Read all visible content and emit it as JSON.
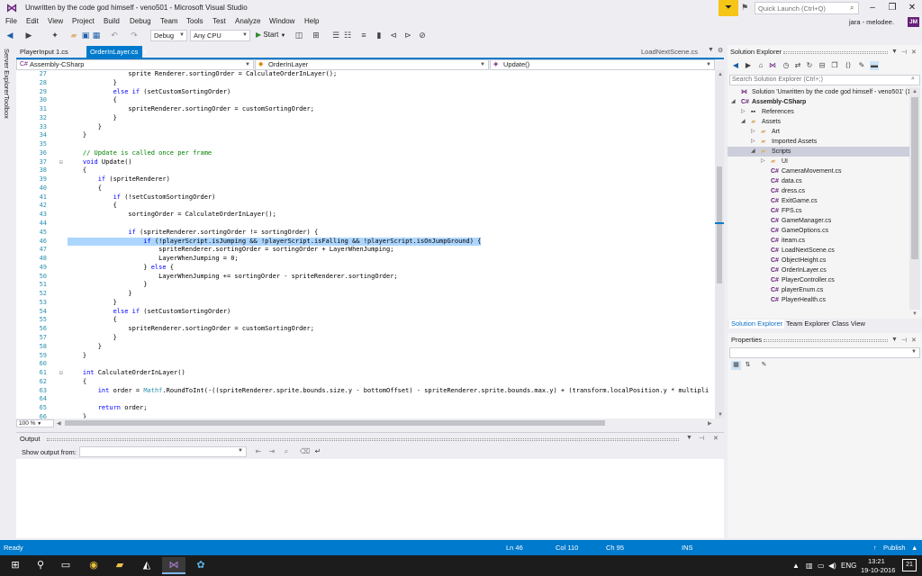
{
  "window": {
    "title": "Unwritten by the code god himself - veno501 - Microsoft Visual Studio",
    "quick_launch_placeholder": "Quick Launch (Ctrl+Q)",
    "user": "jara - melodee.",
    "avatar": "JM"
  },
  "menu": [
    "File",
    "Edit",
    "View",
    "Project",
    "Build",
    "Debug",
    "Team",
    "Tools",
    "Test",
    "Analyze",
    "Window",
    "Help"
  ],
  "toolbar": {
    "config": "Debug",
    "platform": "Any CPU",
    "start_label": "Start"
  },
  "left_strip": [
    "Server Explorer",
    "Toolbox"
  ],
  "tabs": {
    "inactive": "PlayerInput 1.cs",
    "active": "OrderInLayer.cs",
    "preview": "LoadNextScene.cs",
    "close": "×"
  },
  "nav": {
    "project": "Assembly-CSharp",
    "class": "OrderInLayer",
    "member": "Update()"
  },
  "code": [
    {
      "n": "27",
      "t": "                sprite Renderer.sortingOrder = CalculateOrderInLayer();"
    },
    {
      "n": "28",
      "t": "            }"
    },
    {
      "n": "29",
      "t": "            else if (setCustomSortingOrder)"
    },
    {
      "n": "30",
      "t": "            {"
    },
    {
      "n": "31",
      "t": "                spriteRenderer.sortingOrder = customSortingOrder;"
    },
    {
      "n": "32",
      "t": "            }"
    },
    {
      "n": "33",
      "t": "        }"
    },
    {
      "n": "34",
      "t": "    }"
    },
    {
      "n": "35",
      "t": ""
    },
    {
      "n": "36",
      "t": "    // Update is called once per frame"
    },
    {
      "n": "37",
      "t": "    void Update()"
    },
    {
      "n": "38",
      "t": "    {"
    },
    {
      "n": "39",
      "t": "        if (spriteRenderer)"
    },
    {
      "n": "40",
      "t": "        {"
    },
    {
      "n": "41",
      "t": "            if (!setCustomSortingOrder)"
    },
    {
      "n": "42",
      "t": "            {"
    },
    {
      "n": "43",
      "t": "                sortingOrder = CalculateOrderInLayer();"
    },
    {
      "n": "44",
      "t": ""
    },
    {
      "n": "45",
      "t": "                if (spriteRenderer.sortingOrder != sortingOrder) {"
    },
    {
      "n": "46",
      "t": "                    if (!playerScript.isJumping && !playerScript.isFalling && !playerScript.isOnJumpGround) {"
    },
    {
      "n": "47",
      "t": "                        spriteRenderer.sortingOrder = sortingOrder + LayerWhenJumping;"
    },
    {
      "n": "48",
      "t": "                        LayerWhenJumping = 0;"
    },
    {
      "n": "49",
      "t": "                    } else {"
    },
    {
      "n": "50",
      "t": "                        LayerWhenJumping += sortingOrder - spriteRenderer.sortingOrder;"
    },
    {
      "n": "51",
      "t": "                    }"
    },
    {
      "n": "52",
      "t": "                }"
    },
    {
      "n": "53",
      "t": "            }"
    },
    {
      "n": "54",
      "t": "            else if (setCustomSortingOrder)"
    },
    {
      "n": "55",
      "t": "            {"
    },
    {
      "n": "56",
      "t": "                spriteRenderer.sortingOrder = customSortingOrder;"
    },
    {
      "n": "57",
      "t": "            }"
    },
    {
      "n": "58",
      "t": "        }"
    },
    {
      "n": "59",
      "t": "    }"
    },
    {
      "n": "60",
      "t": ""
    },
    {
      "n": "61",
      "t": "    int CalculateOrderInLayer()"
    },
    {
      "n": "62",
      "t": "    {"
    },
    {
      "n": "63",
      "t": "        int order = Mathf.RoundToInt(-((spriteRenderer.sprite.bounds.size.y - bottomOffset) - spriteRenderer.sprite.bounds.max.y) + (transform.localPosition.y * multipli"
    },
    {
      "n": "64",
      "t": ""
    },
    {
      "n": "65",
      "t": "        return order;"
    },
    {
      "n": "66",
      "t": "    }"
    }
  ],
  "highlight_line": "46",
  "editor_zoom": "100 %",
  "output": {
    "title": "Output",
    "show_from_label": "Show output from:"
  },
  "solution": {
    "title": "Solution Explorer",
    "search_placeholder": "Search Solution Explorer (Ctrl+;)",
    "tree": [
      {
        "label": "Solution 'Unwritten by the code god himself - veno501' (1 project)",
        "depth": 0,
        "kind": "solution"
      },
      {
        "label": "Assembly-CSharp",
        "depth": 0,
        "kind": "project",
        "expanded": true
      },
      {
        "label": "References",
        "depth": 1,
        "kind": "ref",
        "expanded": false
      },
      {
        "label": "Assets",
        "depth": 1,
        "kind": "folder",
        "expanded": true
      },
      {
        "label": "Art",
        "depth": 2,
        "kind": "folder",
        "expanded": false
      },
      {
        "label": "Imported Assets",
        "depth": 2,
        "kind": "folder",
        "expanded": false
      },
      {
        "label": "Scripts",
        "depth": 2,
        "kind": "folder",
        "expanded": true,
        "selected": true
      },
      {
        "label": "UI",
        "depth": 3,
        "kind": "folder",
        "expanded": false
      },
      {
        "label": "CameraMovement.cs",
        "depth": 3,
        "kind": "cs"
      },
      {
        "label": "data.cs",
        "depth": 3,
        "kind": "cs"
      },
      {
        "label": "dress.cs",
        "depth": 3,
        "kind": "cs"
      },
      {
        "label": "ExitGame.cs",
        "depth": 3,
        "kind": "cs"
      },
      {
        "label": "FPS.cs",
        "depth": 3,
        "kind": "cs"
      },
      {
        "label": "GameManager.cs",
        "depth": 3,
        "kind": "cs"
      },
      {
        "label": "GameOptions.cs",
        "depth": 3,
        "kind": "cs"
      },
      {
        "label": "iteam.cs",
        "depth": 3,
        "kind": "cs"
      },
      {
        "label": "LoadNextScene.cs",
        "depth": 3,
        "kind": "cs"
      },
      {
        "label": "ObjectHeight.cs",
        "depth": 3,
        "kind": "cs"
      },
      {
        "label": "OrderInLayer.cs",
        "depth": 3,
        "kind": "cs"
      },
      {
        "label": "PlayerController.cs",
        "depth": 3,
        "kind": "cs"
      },
      {
        "label": "playerEnum.cs",
        "depth": 3,
        "kind": "cs"
      },
      {
        "label": "PlayerHealth.cs",
        "depth": 3,
        "kind": "cs"
      }
    ],
    "tabs": [
      "Solution Explorer",
      "Team Explorer",
      "Class View"
    ]
  },
  "properties": {
    "title": "Properties"
  },
  "status": {
    "ready": "Ready",
    "ln": "Ln 46",
    "col": "Col 110",
    "ch": "Ch 95",
    "mode": "INS",
    "publish": "Publish",
    "badge": "21"
  },
  "taskbar": {
    "lang": "ENG",
    "time": "13:21",
    "date": "19-10-2016"
  },
  "colors": {
    "accent": "#007acc",
    "vs_purple": "#68217a",
    "highlight": "#add6ff"
  }
}
